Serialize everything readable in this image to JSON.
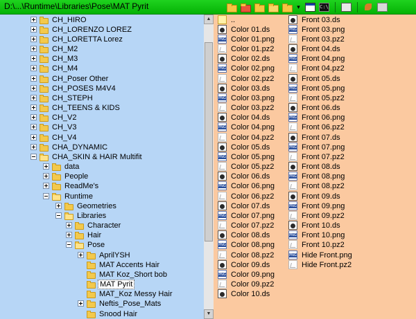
{
  "titlebar": {
    "path": "D:\\...\\Runtime\\Libraries\\Pose\\MAT Pyrit",
    "icons": [
      "folder-icon",
      "folder-red-icon",
      "folder-icon",
      "folder-pen-icon",
      "folder-icon",
      "dropdown-arrow-icon",
      "window-icon",
      "cmd-icon",
      "panel-icon",
      "tools-icon",
      "options-icon"
    ]
  },
  "tree": {
    "nodes": [
      {
        "label": "CH_HIRO",
        "depth": 0,
        "expander": "plus"
      },
      {
        "label": "CH_LORENZO LOREZ",
        "depth": 0,
        "expander": "plus"
      },
      {
        "label": "CH_LORETTA Lorez",
        "depth": 0,
        "expander": "plus"
      },
      {
        "label": "CH_M2",
        "depth": 0,
        "expander": "plus"
      },
      {
        "label": "CH_M3",
        "depth": 0,
        "expander": "plus"
      },
      {
        "label": "CH_M4",
        "depth": 0,
        "expander": "plus"
      },
      {
        "label": "CH_Poser Other",
        "depth": 0,
        "expander": "plus"
      },
      {
        "label": "CH_POSES M4V4",
        "depth": 0,
        "expander": "plus"
      },
      {
        "label": "CH_STEPH",
        "depth": 0,
        "expander": "plus"
      },
      {
        "label": "CH_TEENS & KIDS",
        "depth": 0,
        "expander": "plus"
      },
      {
        "label": "CH_V2",
        "depth": 0,
        "expander": "plus"
      },
      {
        "label": "CH_V3",
        "depth": 0,
        "expander": "plus"
      },
      {
        "label": "CH_V4",
        "depth": 0,
        "expander": "plus"
      },
      {
        "label": "CHA_DYNAMIC",
        "depth": 0,
        "expander": "plus"
      },
      {
        "label": "CHA_SKIN & HAIR Multifit",
        "depth": 0,
        "expander": "minus"
      },
      {
        "label": "data",
        "depth": 1,
        "expander": "plus"
      },
      {
        "label": "People",
        "depth": 1,
        "expander": "plus"
      },
      {
        "label": "ReadMe's",
        "depth": 1,
        "expander": "plus"
      },
      {
        "label": "Runtime",
        "depth": 1,
        "expander": "minus"
      },
      {
        "label": "Geometries",
        "depth": 2,
        "expander": "plus"
      },
      {
        "label": "Libraries",
        "depth": 2,
        "expander": "minus"
      },
      {
        "label": "Character",
        "depth": 3,
        "expander": "plus"
      },
      {
        "label": "Hair",
        "depth": 3,
        "expander": "plus"
      },
      {
        "label": "Pose",
        "depth": 3,
        "expander": "minus"
      },
      {
        "label": "AprilYSH",
        "depth": 4,
        "expander": "plus"
      },
      {
        "label": "MAT Accents Hair",
        "depth": 4,
        "expander": "none"
      },
      {
        "label": "MAT Koz_Short bob",
        "depth": 4,
        "expander": "none"
      },
      {
        "label": "MAT Pyrit",
        "depth": 4,
        "expander": "none",
        "selected": true
      },
      {
        "label": "MAT_Koz Messy Hair",
        "depth": 4,
        "expander": "none"
      },
      {
        "label": "Neftis_Pose_Mats",
        "depth": 4,
        "expander": "plus"
      },
      {
        "label": "Snood Hair",
        "depth": 4,
        "expander": "none"
      }
    ]
  },
  "files": {
    "column1": [
      {
        "name": "..",
        "type": "up"
      },
      {
        "name": "Color 01.ds",
        "type": "ds"
      },
      {
        "name": "Color 01.png",
        "type": "png"
      },
      {
        "name": "Color 01.pz2",
        "type": "pz2"
      },
      {
        "name": "Color 02.ds",
        "type": "ds"
      },
      {
        "name": "Color 02.png",
        "type": "png"
      },
      {
        "name": "Color 02.pz2",
        "type": "pz2"
      },
      {
        "name": "Color 03.ds",
        "type": "ds"
      },
      {
        "name": "Color 03.png",
        "type": "png"
      },
      {
        "name": "Color 03.pz2",
        "type": "pz2"
      },
      {
        "name": "Color 04.ds",
        "type": "ds"
      },
      {
        "name": "Color 04.png",
        "type": "png"
      },
      {
        "name": "Color 04.pz2",
        "type": "pz2"
      },
      {
        "name": "Color 05.ds",
        "type": "ds"
      },
      {
        "name": "Color 05.png",
        "type": "png"
      },
      {
        "name": "Color 05.pz2",
        "type": "pz2"
      },
      {
        "name": "Color 06.ds",
        "type": "ds"
      },
      {
        "name": "Color 06.png",
        "type": "png"
      },
      {
        "name": "Color 06.pz2",
        "type": "pz2"
      },
      {
        "name": "Color 07.ds",
        "type": "ds"
      },
      {
        "name": "Color 07.png",
        "type": "png"
      },
      {
        "name": "Color 07.pz2",
        "type": "pz2"
      },
      {
        "name": "Color 08.ds",
        "type": "ds"
      },
      {
        "name": "Color 08.png",
        "type": "png"
      },
      {
        "name": "Color 08.pz2",
        "type": "pz2"
      },
      {
        "name": "Color 09.ds",
        "type": "ds"
      },
      {
        "name": "Color 09.png",
        "type": "png"
      },
      {
        "name": "Color 09.pz2",
        "type": "pz2"
      },
      {
        "name": "Color 10.ds",
        "type": "ds"
      }
    ],
    "column2": [
      {
        "name": "Front 03.ds",
        "type": "ds"
      },
      {
        "name": "Front 03.png",
        "type": "png"
      },
      {
        "name": "Front 03.pz2",
        "type": "pz2"
      },
      {
        "name": "Front 04.ds",
        "type": "ds"
      },
      {
        "name": "Front 04.png",
        "type": "png"
      },
      {
        "name": "Front 04.pz2",
        "type": "pz2"
      },
      {
        "name": "Front 05.ds",
        "type": "ds"
      },
      {
        "name": "Front 05.png",
        "type": "png"
      },
      {
        "name": "Front 05.pz2",
        "type": "pz2"
      },
      {
        "name": "Front 06.ds",
        "type": "ds"
      },
      {
        "name": "Front 06.png",
        "type": "png"
      },
      {
        "name": "Front 06.pz2",
        "type": "pz2"
      },
      {
        "name": "Front 07.ds",
        "type": "ds"
      },
      {
        "name": "Front 07.png",
        "type": "png"
      },
      {
        "name": "Front 07.pz2",
        "type": "pz2"
      },
      {
        "name": "Front 08.ds",
        "type": "ds"
      },
      {
        "name": "Front 08.png",
        "type": "png"
      },
      {
        "name": "Front 08.pz2",
        "type": "pz2"
      },
      {
        "name": "Front 09.ds",
        "type": "ds"
      },
      {
        "name": "Front 09.png",
        "type": "png"
      },
      {
        "name": "Front 09.pz2",
        "type": "pz2"
      },
      {
        "name": "Front 10.ds",
        "type": "ds"
      },
      {
        "name": "Front 10.png",
        "type": "png"
      },
      {
        "name": "Front 10.pz2",
        "type": "pz2"
      },
      {
        "name": "Hide Front.png",
        "type": "png"
      },
      {
        "name": "Hide Front.pz2",
        "type": "pz2"
      }
    ]
  },
  "colors": {
    "titlebar": "#05b305",
    "tree_bg": "#b7d6f6",
    "files_bg": "#fbc9a0"
  }
}
